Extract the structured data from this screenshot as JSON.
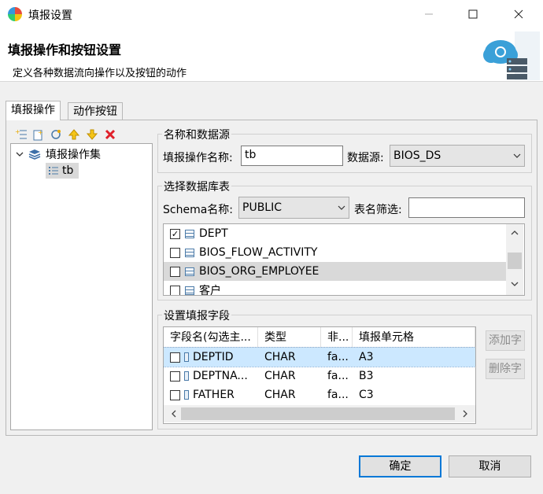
{
  "window": {
    "title": "填报设置"
  },
  "banner": {
    "title": "填报操作和按钮设置",
    "description": "定义各种数据流向操作以及按钮的动作"
  },
  "tabs": [
    {
      "label": "填报操作",
      "active": true
    },
    {
      "label": "动作按钮",
      "active": false
    }
  ],
  "toolbar": {
    "icons": [
      "add-icon",
      "add-child-icon",
      "refresh-icon",
      "move-up-icon",
      "move-down-icon",
      "delete-icon"
    ]
  },
  "tree": {
    "root": "填报操作集",
    "child": "tb"
  },
  "name_source": {
    "group_label": "名称和数据源",
    "name_label": "填报操作名称:",
    "name_value": "tb",
    "source_label": "数据源:",
    "source_value": "BIOS_DS"
  },
  "db_table": {
    "group_label": "选择数据库表",
    "schema_label": "Schema名称:",
    "schema_value": "PUBLIC",
    "filter_label": "表名筛选:",
    "filter_value": "",
    "tables": [
      {
        "name": "DEPT",
        "checked": true,
        "selected": false
      },
      {
        "name": "BIOS_FLOW_ACTIVITY",
        "checked": false,
        "selected": false
      },
      {
        "name": "BIOS_ORG_EMPLOYEE",
        "checked": false,
        "selected": true
      },
      {
        "name": "客户",
        "checked": false,
        "selected": false
      }
    ]
  },
  "fields": {
    "group_label": "设置填报字段",
    "headers": [
      "字段名(勾选主...",
      "类型",
      "非...",
      "填报单元格"
    ],
    "rows": [
      {
        "name": "DEPTID",
        "type": "CHAR",
        "nonnull": "fa...",
        "cell": "A3",
        "selected": true
      },
      {
        "name": "DEPTNA...",
        "type": "CHAR",
        "nonnull": "fa...",
        "cell": "B3",
        "selected": false
      },
      {
        "name": "FATHER",
        "type": "CHAR",
        "nonnull": "fa...",
        "cell": "C3",
        "selected": false
      }
    ],
    "add_button": "添加字",
    "remove_button": "删除字"
  },
  "footer": {
    "ok": "确定",
    "cancel": "取消"
  },
  "colors": {
    "selection": "#cce8ff",
    "accent": "#0078d7",
    "delete": "#e0202a",
    "arrow": "#e6a800"
  }
}
